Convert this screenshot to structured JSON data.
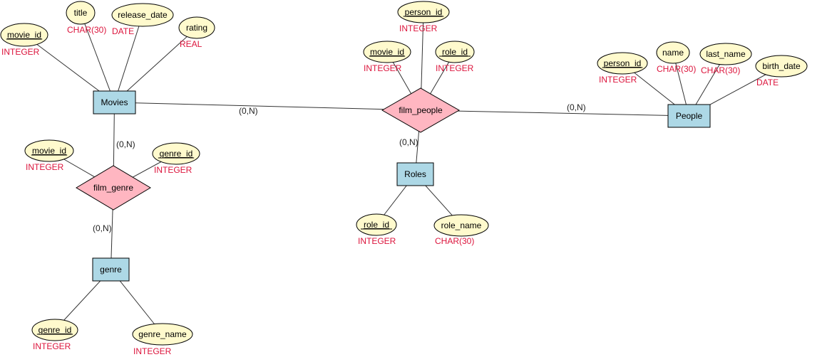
{
  "diagram": {
    "type": "er-diagram",
    "entities": [
      {
        "id": "movies",
        "label": "Movies"
      },
      {
        "id": "people",
        "label": "People"
      },
      {
        "id": "roles",
        "label": "Roles"
      },
      {
        "id": "genre",
        "label": "genre"
      }
    ],
    "relationships": [
      {
        "id": "film_people",
        "label": "film_people"
      },
      {
        "id": "film_genre",
        "label": "film_genre"
      }
    ],
    "attributes": [
      {
        "id": "movies_movie_id",
        "owner": "movies",
        "label": "movie_id",
        "type": "INTEGER",
        "key": true
      },
      {
        "id": "movies_title",
        "owner": "movies",
        "label": "title",
        "type": "CHAR(30)",
        "key": false
      },
      {
        "id": "movies_release_date",
        "owner": "movies",
        "label": "release_date",
        "type": "DATE",
        "key": false
      },
      {
        "id": "movies_rating",
        "owner": "movies",
        "label": "rating",
        "type": "REAL",
        "key": false
      },
      {
        "id": "fp_person_id",
        "owner": "film_people",
        "label": "person_id",
        "type": "INTEGER",
        "key": true
      },
      {
        "id": "fp_movie_id",
        "owner": "film_people",
        "label": "movie_id",
        "type": "INTEGER",
        "key": true
      },
      {
        "id": "fp_role_id",
        "owner": "film_people",
        "label": "role_id",
        "type": "INTEGER",
        "key": true
      },
      {
        "id": "people_person_id",
        "owner": "people",
        "label": "person_id",
        "type": "INTEGER",
        "key": true
      },
      {
        "id": "people_name",
        "owner": "people",
        "label": "name",
        "type": "CHAR(30)",
        "key": false
      },
      {
        "id": "people_last_name",
        "owner": "people",
        "label": "last_name",
        "type": "CHAR(30)",
        "key": false
      },
      {
        "id": "people_birth_date",
        "owner": "people",
        "label": "birth_date",
        "type": "DATE",
        "key": false
      },
      {
        "id": "fg_movie_id",
        "owner": "film_genre",
        "label": "movie_id",
        "type": "INTEGER",
        "key": true
      },
      {
        "id": "fg_genre_id",
        "owner": "film_genre",
        "label": "genre_id",
        "type": "INTEGER",
        "key": true
      },
      {
        "id": "roles_role_id",
        "owner": "roles",
        "label": "role_id",
        "type": "INTEGER",
        "key": true
      },
      {
        "id": "roles_role_name",
        "owner": "roles",
        "label": "role_name",
        "type": "CHAR(30)",
        "key": false
      },
      {
        "id": "genre_genre_id",
        "owner": "genre",
        "label": "genre_id",
        "type": "INTEGER",
        "key": true
      },
      {
        "id": "genre_genre_name",
        "owner": "genre",
        "label": "genre_name",
        "type": "INTEGER",
        "key": false
      }
    ],
    "links": [
      {
        "from": "movies",
        "to": "film_people",
        "cardinality": "(0,N)"
      },
      {
        "from": "people",
        "to": "film_people",
        "cardinality": "(0,N)"
      },
      {
        "from": "roles",
        "to": "film_people",
        "cardinality": "(0,N)"
      },
      {
        "from": "movies",
        "to": "film_genre",
        "cardinality": "(0,N)"
      },
      {
        "from": "genre",
        "to": "film_genre",
        "cardinality": "(0,N)"
      }
    ],
    "colors": {
      "entity_fill": "#add8e6",
      "relationship_fill": "#ffb6c1",
      "attribute_fill": "#fffacd",
      "type_text": "#dc143c"
    }
  }
}
